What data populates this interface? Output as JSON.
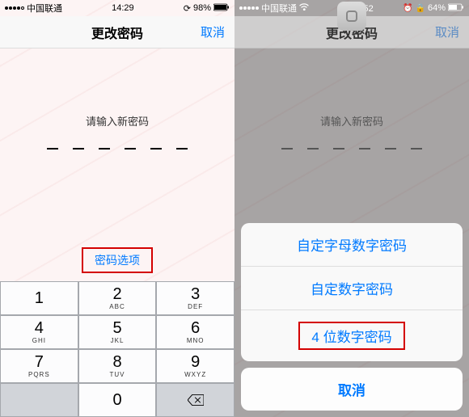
{
  "left": {
    "status": {
      "carrier": "中国联通",
      "time": "14:29",
      "battery_pct": "98%",
      "battery_icon": "full"
    },
    "nav": {
      "title": "更改密码",
      "cancel": "取消"
    },
    "prompt": "请输入新密码",
    "options_label": "密码选项",
    "keypad": [
      [
        {
          "n": "1",
          "l": ""
        },
        {
          "n": "2",
          "l": "ABC"
        },
        {
          "n": "3",
          "l": "DEF"
        }
      ],
      [
        {
          "n": "4",
          "l": "GHI"
        },
        {
          "n": "5",
          "l": "JKL"
        },
        {
          "n": "6",
          "l": "MNO"
        }
      ],
      [
        {
          "n": "7",
          "l": "PQRS"
        },
        {
          "n": "8",
          "l": "TUV"
        },
        {
          "n": "9",
          "l": "WXYZ"
        }
      ],
      [
        {
          "blank": true
        },
        {
          "n": "0",
          "l": ""
        },
        {
          "backspace": true
        }
      ]
    ]
  },
  "right": {
    "status": {
      "carrier": "中国联通",
      "time": "下午1:52",
      "battery_pct": "64%"
    },
    "nav": {
      "title": "更改密码",
      "cancel": "取消"
    },
    "prompt": "请输入新密码",
    "sheet": {
      "opt1": "自定字母数字密码",
      "opt2": "自定数字密码",
      "opt3": "4 位数字密码",
      "cancel": "取消"
    }
  }
}
